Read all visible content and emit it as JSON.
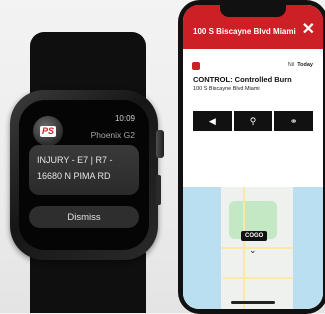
{
  "watch": {
    "time": "10:09",
    "logo_text": "PS",
    "app_name": "Phoenix G2",
    "message_line1": "INJURY - E7 | R7 -",
    "message_line2": "16680 N PIMA RD",
    "dismiss_label": "Dismiss"
  },
  "phone": {
    "header_title": "100 S Biscayne Blvd Miami",
    "close_icon": "close-icon",
    "incident_time": "Nil",
    "incident_day": "Today",
    "incident_title": "CONTROL: Controlled Burn",
    "incident_address": "100 S Biscayne Blvd Miami",
    "actions": [
      {
        "icon": "navigate-icon",
        "glyph": "◀"
      },
      {
        "icon": "pin-icon",
        "glyph": "⚲"
      },
      {
        "icon": "binoculars-icon",
        "glyph": "⚭"
      }
    ],
    "map": {
      "marker_label": "COGO",
      "chevron": "⌄"
    },
    "accent_color": "#cd1f26"
  }
}
